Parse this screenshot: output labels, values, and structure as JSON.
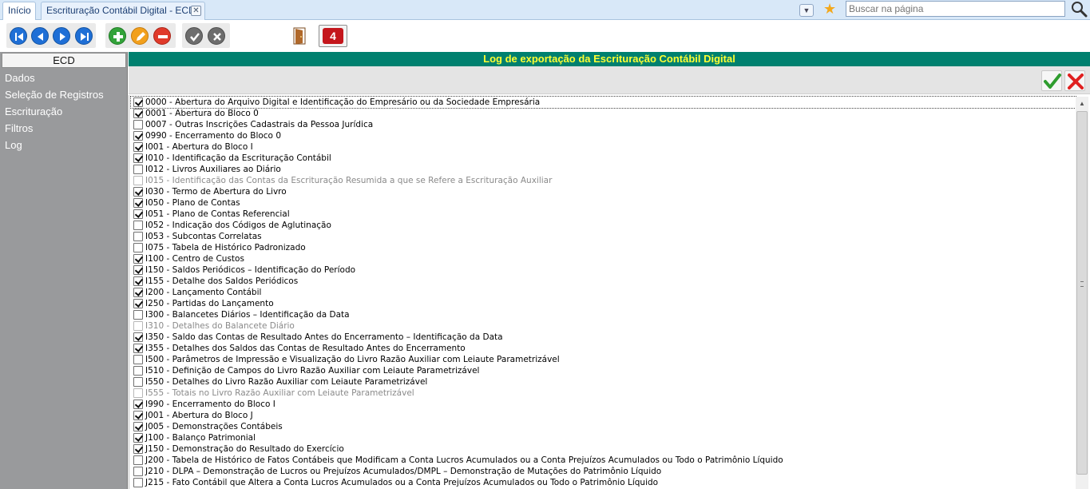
{
  "tabs": {
    "home_label": "Início",
    "active_label": "Escrituração Contábil Digital - ECD",
    "close_glyph": "⊠"
  },
  "search": {
    "placeholder": "Buscar na página"
  },
  "toolbar": {
    "buttons": [
      {
        "name": "first-record-icon",
        "glyph": "⏮"
      },
      {
        "name": "previous-record-icon",
        "glyph": "◀"
      },
      {
        "name": "next-record-icon",
        "glyph": "▶"
      },
      {
        "name": "last-record-icon",
        "glyph": "⏭"
      },
      {
        "name": "add-icon",
        "glyph": "+"
      },
      {
        "name": "edit-icon",
        "glyph": "✎"
      },
      {
        "name": "remove-icon",
        "glyph": "−"
      },
      {
        "name": "confirm-icon",
        "glyph": "✔"
      },
      {
        "name": "cancel-icon",
        "glyph": "✖"
      }
    ],
    "exit_icon": "door-icon",
    "logo_icon": "company-logo-icon",
    "colors": {
      "nav": "#1f6fd6",
      "add": "#33a33a",
      "edit": "#f2a01c",
      "remove": "#e03a2a",
      "disabled": "#6d6d6d"
    }
  },
  "sidebar": {
    "header": "ECD",
    "items": [
      "Dados",
      "Seleção de Registros",
      "Escrituração",
      "Filtros",
      "Log"
    ]
  },
  "main": {
    "title": "Log de exportação da Escrituração Contábil Digital",
    "title_bg": "#00806f",
    "title_color": "#ffff33",
    "confirm_icon": "green-check-icon",
    "cancel_icon": "red-x-icon",
    "registers": [
      {
        "label": "0000 - Abertura do Arquivo Digital e Identificação do Empresário ou da Sociedade Empresária",
        "checked": true,
        "disabled": false
      },
      {
        "label": "0001 - Abertura do Bloco 0",
        "checked": true,
        "disabled": false
      },
      {
        "label": "0007 - Outras Inscrições Cadastrais da Pessoa Jurídica",
        "checked": false,
        "disabled": false
      },
      {
        "label": "0990 - Encerramento do Bloco 0",
        "checked": true,
        "disabled": false
      },
      {
        "label": "I001 - Abertura do Bloco I",
        "checked": true,
        "disabled": false
      },
      {
        "label": "I010 - Identificação da Escrituração Contábil",
        "checked": true,
        "disabled": false
      },
      {
        "label": "I012 - Livros Auxiliares ao Diário",
        "checked": false,
        "disabled": false
      },
      {
        "label": "I015 - Identificação das Contas da Escrituração Resumida a que se Refere a Escrituração Auxiliar",
        "checked": false,
        "disabled": true
      },
      {
        "label": "I030 - Termo de Abertura do Livro",
        "checked": true,
        "disabled": false
      },
      {
        "label": "I050 - Plano de Contas",
        "checked": true,
        "disabled": false
      },
      {
        "label": "I051 - Plano de Contas Referencial",
        "checked": true,
        "disabled": false
      },
      {
        "label": "I052 - Indicação dos Códigos de Aglutinação",
        "checked": false,
        "disabled": false
      },
      {
        "label": "I053 - Subcontas Correlatas",
        "checked": false,
        "disabled": false
      },
      {
        "label": "I075 - Tabela de Histórico Padronizado",
        "checked": false,
        "disabled": false
      },
      {
        "label": "I100 - Centro de Custos",
        "checked": true,
        "disabled": false
      },
      {
        "label": "I150 - Saldos Periódicos – Identificação do Período",
        "checked": true,
        "disabled": false
      },
      {
        "label": "I155 - Detalhe dos Saldos Periódicos",
        "checked": true,
        "disabled": false
      },
      {
        "label": "I200 - Lançamento Contábil",
        "checked": true,
        "disabled": false
      },
      {
        "label": "I250 - Partidas do Lançamento",
        "checked": true,
        "disabled": false
      },
      {
        "label": "I300 - Balancetes Diários – Identificação da Data",
        "checked": false,
        "disabled": false
      },
      {
        "label": "I310 - Detalhes do Balancete Diário",
        "checked": false,
        "disabled": true
      },
      {
        "label": "I350 - Saldo das Contas de Resultado Antes do Encerramento – Identificação da Data",
        "checked": true,
        "disabled": false
      },
      {
        "label": "I355 - Detalhes dos Saldos das Contas de Resultado Antes do Encerramento",
        "checked": true,
        "disabled": false
      },
      {
        "label": "I500 - Parâmetros de Impressão e Visualização do Livro Razão Auxiliar com Leiaute Parametrizável",
        "checked": false,
        "disabled": false
      },
      {
        "label": "I510 - Definição de Campos do Livro Razão Auxiliar com Leiaute Parametrizável",
        "checked": false,
        "disabled": false
      },
      {
        "label": "I550 - Detalhes do Livro Razão Auxiliar com Leiaute Parametrizável",
        "checked": false,
        "disabled": false
      },
      {
        "label": "I555 - Totais no Livro Razão Auxiliar com Leiaute Parametrizável",
        "checked": false,
        "disabled": true
      },
      {
        "label": "I990 - Encerramento do Bloco I",
        "checked": true,
        "disabled": false
      },
      {
        "label": "J001 - Abertura do Bloco J",
        "checked": true,
        "disabled": false
      },
      {
        "label": "J005 - Demonstrações Contábeis",
        "checked": true,
        "disabled": false
      },
      {
        "label": "J100 - Balanço Patrimonial",
        "checked": true,
        "disabled": false
      },
      {
        "label": "J150 - Demonstração do Resultado do Exercício",
        "checked": true,
        "disabled": false
      },
      {
        "label": "J200 - Tabela de Histórico de Fatos Contábeis que Modificam a Conta Lucros Acumulados ou a Conta Prejuízos Acumulados ou Todo o Patrimônio Líquido",
        "checked": false,
        "disabled": false
      },
      {
        "label": "J210 - DLPA – Demonstração de Lucros ou Prejuízos Acumulados/DMPL – Demonstração de Mutações do Patrimônio Líquido",
        "checked": false,
        "disabled": false
      },
      {
        "label": "J215 - Fato Contábil que Altera a Conta Lucros Acumulados ou a Conta Prejuízos Acumulados ou Todo o Patrimônio Líquido",
        "checked": false,
        "disabled": false
      }
    ]
  }
}
